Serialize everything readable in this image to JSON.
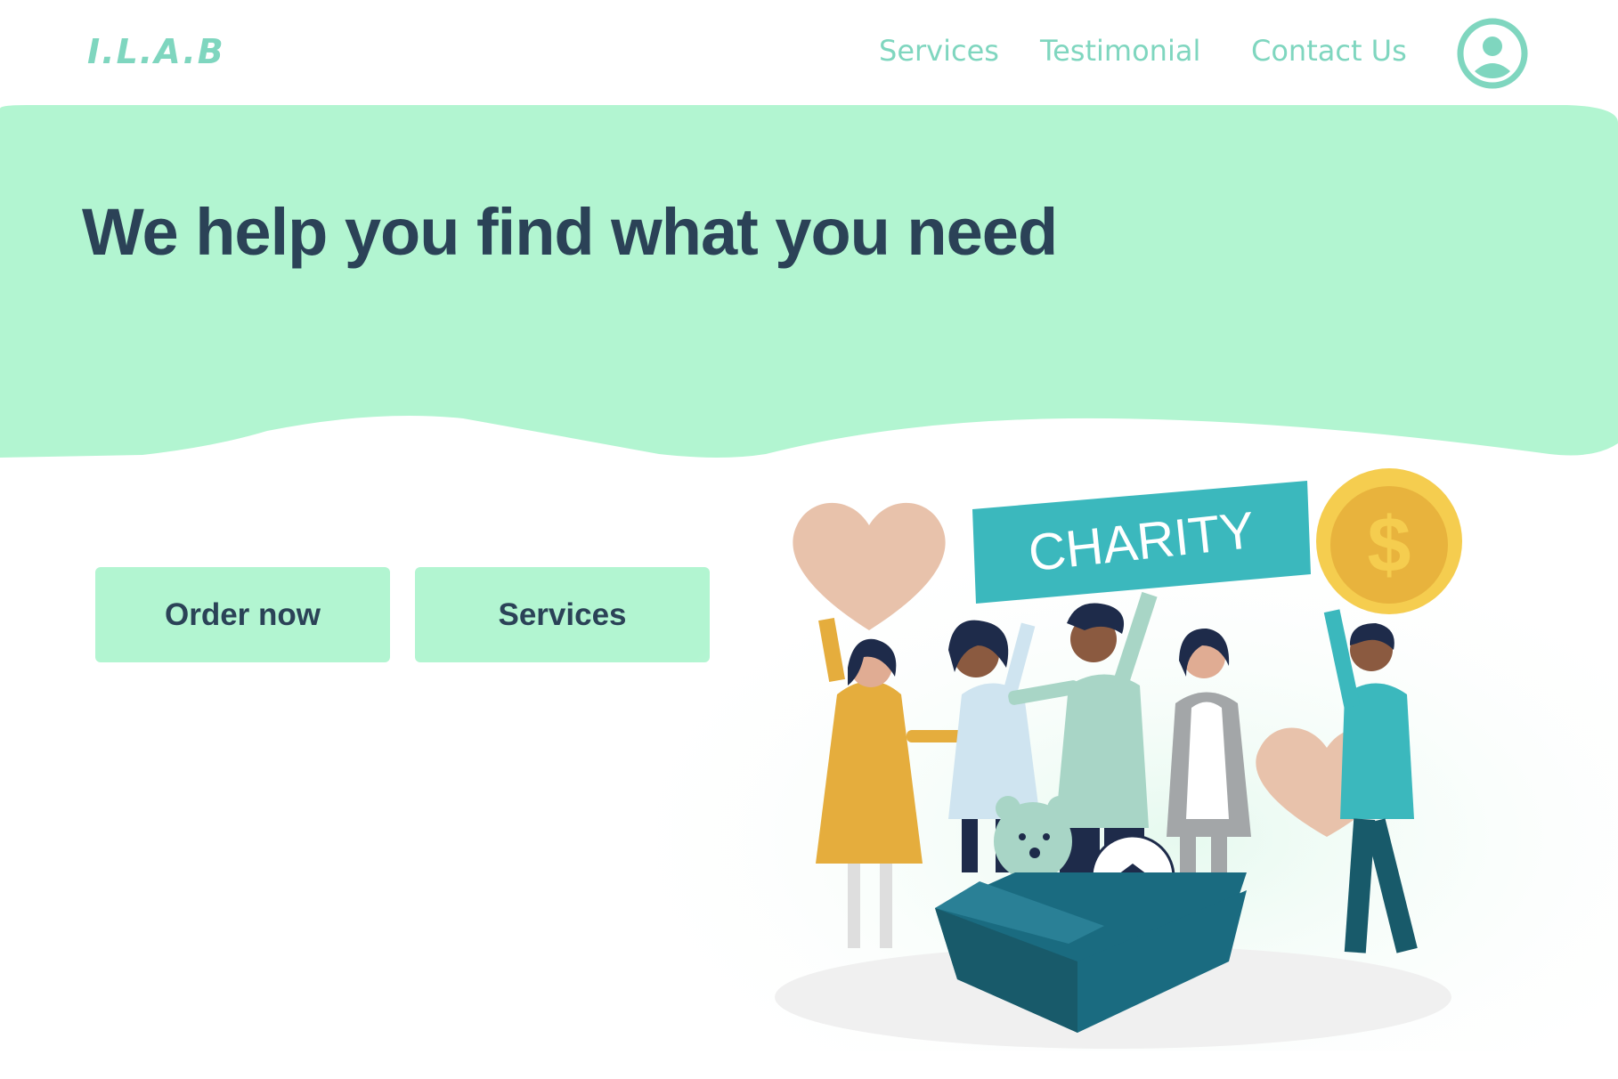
{
  "header": {
    "logo": "I.L.A.B",
    "nav": [
      {
        "label": "Services"
      },
      {
        "label": "Testimonial"
      },
      {
        "label": "Contact Us"
      }
    ],
    "user_icon": "user-circle-icon"
  },
  "hero": {
    "title": "We help you find what you need"
  },
  "actions": {
    "order_label": "Order now",
    "services_label": "Services"
  },
  "illustration": {
    "banner_text": "CHARITY",
    "coin_symbol": "$"
  },
  "colors": {
    "accent": "#7fd6bf",
    "hero_band": "#b2f5d1",
    "title": "#2b4257",
    "button_bg": "#b2f5d1"
  }
}
